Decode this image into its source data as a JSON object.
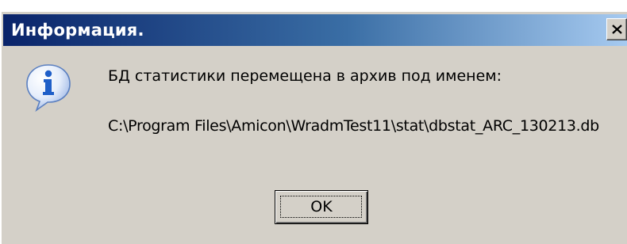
{
  "window": {
    "title": "Информация.",
    "close_icon": "close-icon"
  },
  "content": {
    "icon": "info-icon",
    "message": "БД статистики перемещена в архив под именем:",
    "path": "C:\\Program Files\\Amicon\\WradmTest11\\stat\\dbstat_ARC_130213.db"
  },
  "buttons": {
    "ok_label": "OK"
  },
  "colors": {
    "titlebar_start": "#0a246a",
    "titlebar_end": "#a6caf0",
    "dialog_bg": "#d4d0c8",
    "icon_blue": "#1f5fc8"
  }
}
